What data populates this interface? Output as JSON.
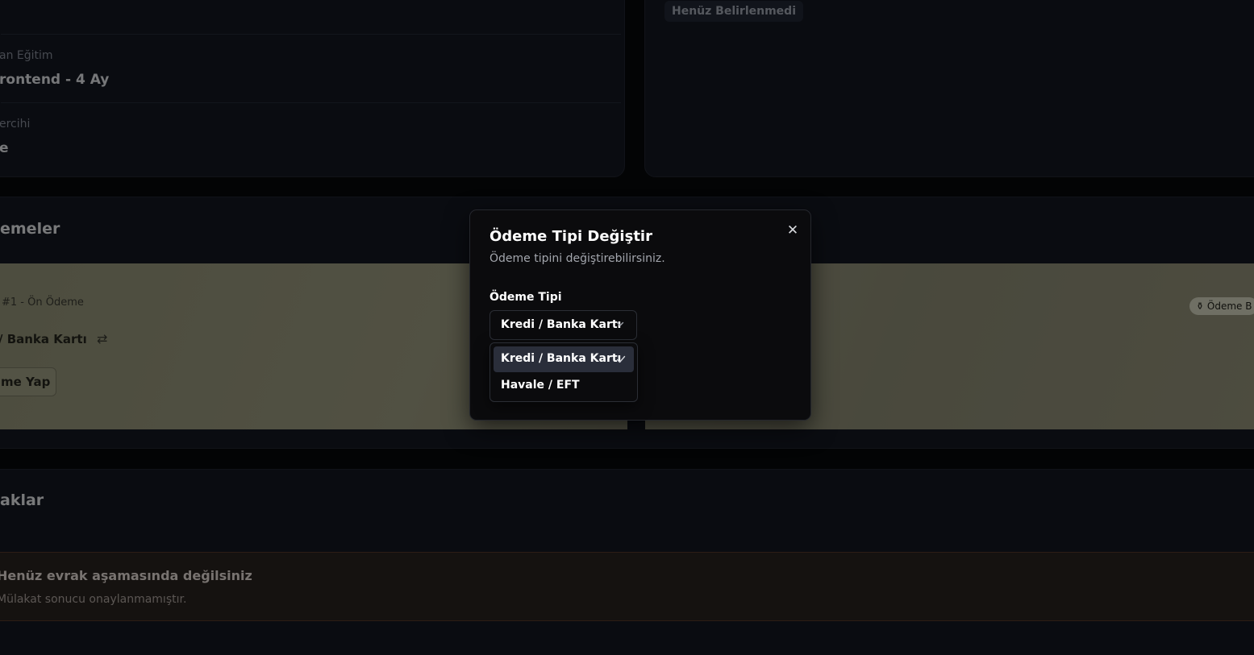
{
  "profile": {
    "education_label": "an Eğitim",
    "education_value": "rontend - 4 Ay",
    "preference_label": "ercihi",
    "preference_value": "e"
  },
  "status_card": {
    "badge": "Henüz Belirlenmedi"
  },
  "payments": {
    "section_title": "emeler",
    "item_label": "#1 - Ön Ödeme",
    "method": "/ Banka Kartı",
    "pay_button": "me Yap",
    "status_badge": "Ödeme B"
  },
  "documents": {
    "section_title": "aklar",
    "alert_title": "Henüz evrak aşamasında değilsiniz",
    "alert_subtitle": "Mülakat sonucu onaylanmamıştır."
  },
  "modal": {
    "title": "Ödeme Tipi Değiştir",
    "description": "Ödeme tipini değiştirebilirsiniz.",
    "field_label": "Ödeme Tipi",
    "selected_value": "Kredi / Banka Kartı",
    "options": [
      {
        "label": "Kredi / Banka Kartı",
        "selected": true
      },
      {
        "label": "Havale / EFT",
        "selected": false
      }
    ]
  },
  "icons": {
    "close": "close-icon",
    "chevron": "chevron-down-icon",
    "check": "check-icon",
    "swap": "swap-arrows-icon",
    "badge": "coin-icon"
  }
}
